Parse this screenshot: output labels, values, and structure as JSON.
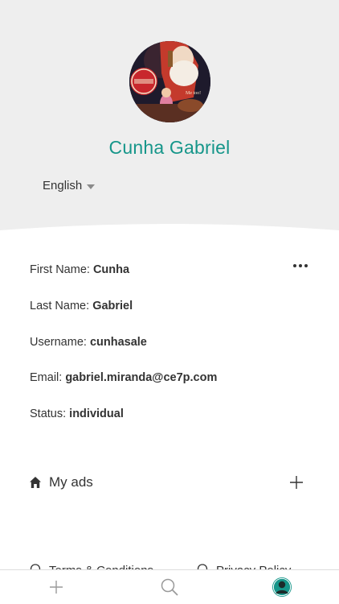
{
  "profile": {
    "name": "Cunha Gabriel",
    "language": "English"
  },
  "details": [
    {
      "label": "First Name:",
      "value": "Cunha"
    },
    {
      "label": "Last Name:",
      "value": "Gabriel"
    },
    {
      "label": "Username:",
      "value": "cunhasale"
    },
    {
      "label": "Email:",
      "value": "gabriel.miranda@ce7p.com"
    },
    {
      "label": "Status:",
      "value": "individual"
    }
  ],
  "sections": {
    "my_ads": "My ads"
  },
  "links": {
    "terms": "Terms & Conditions",
    "privacy": "Privacy Policy"
  },
  "tabs": [
    {
      "icon": "plus-icon"
    },
    {
      "icon": "search-icon"
    },
    {
      "icon": "profile-icon",
      "active": true
    }
  ],
  "colors": {
    "accent": "#16968a",
    "header_bg": "#eeeeee"
  }
}
